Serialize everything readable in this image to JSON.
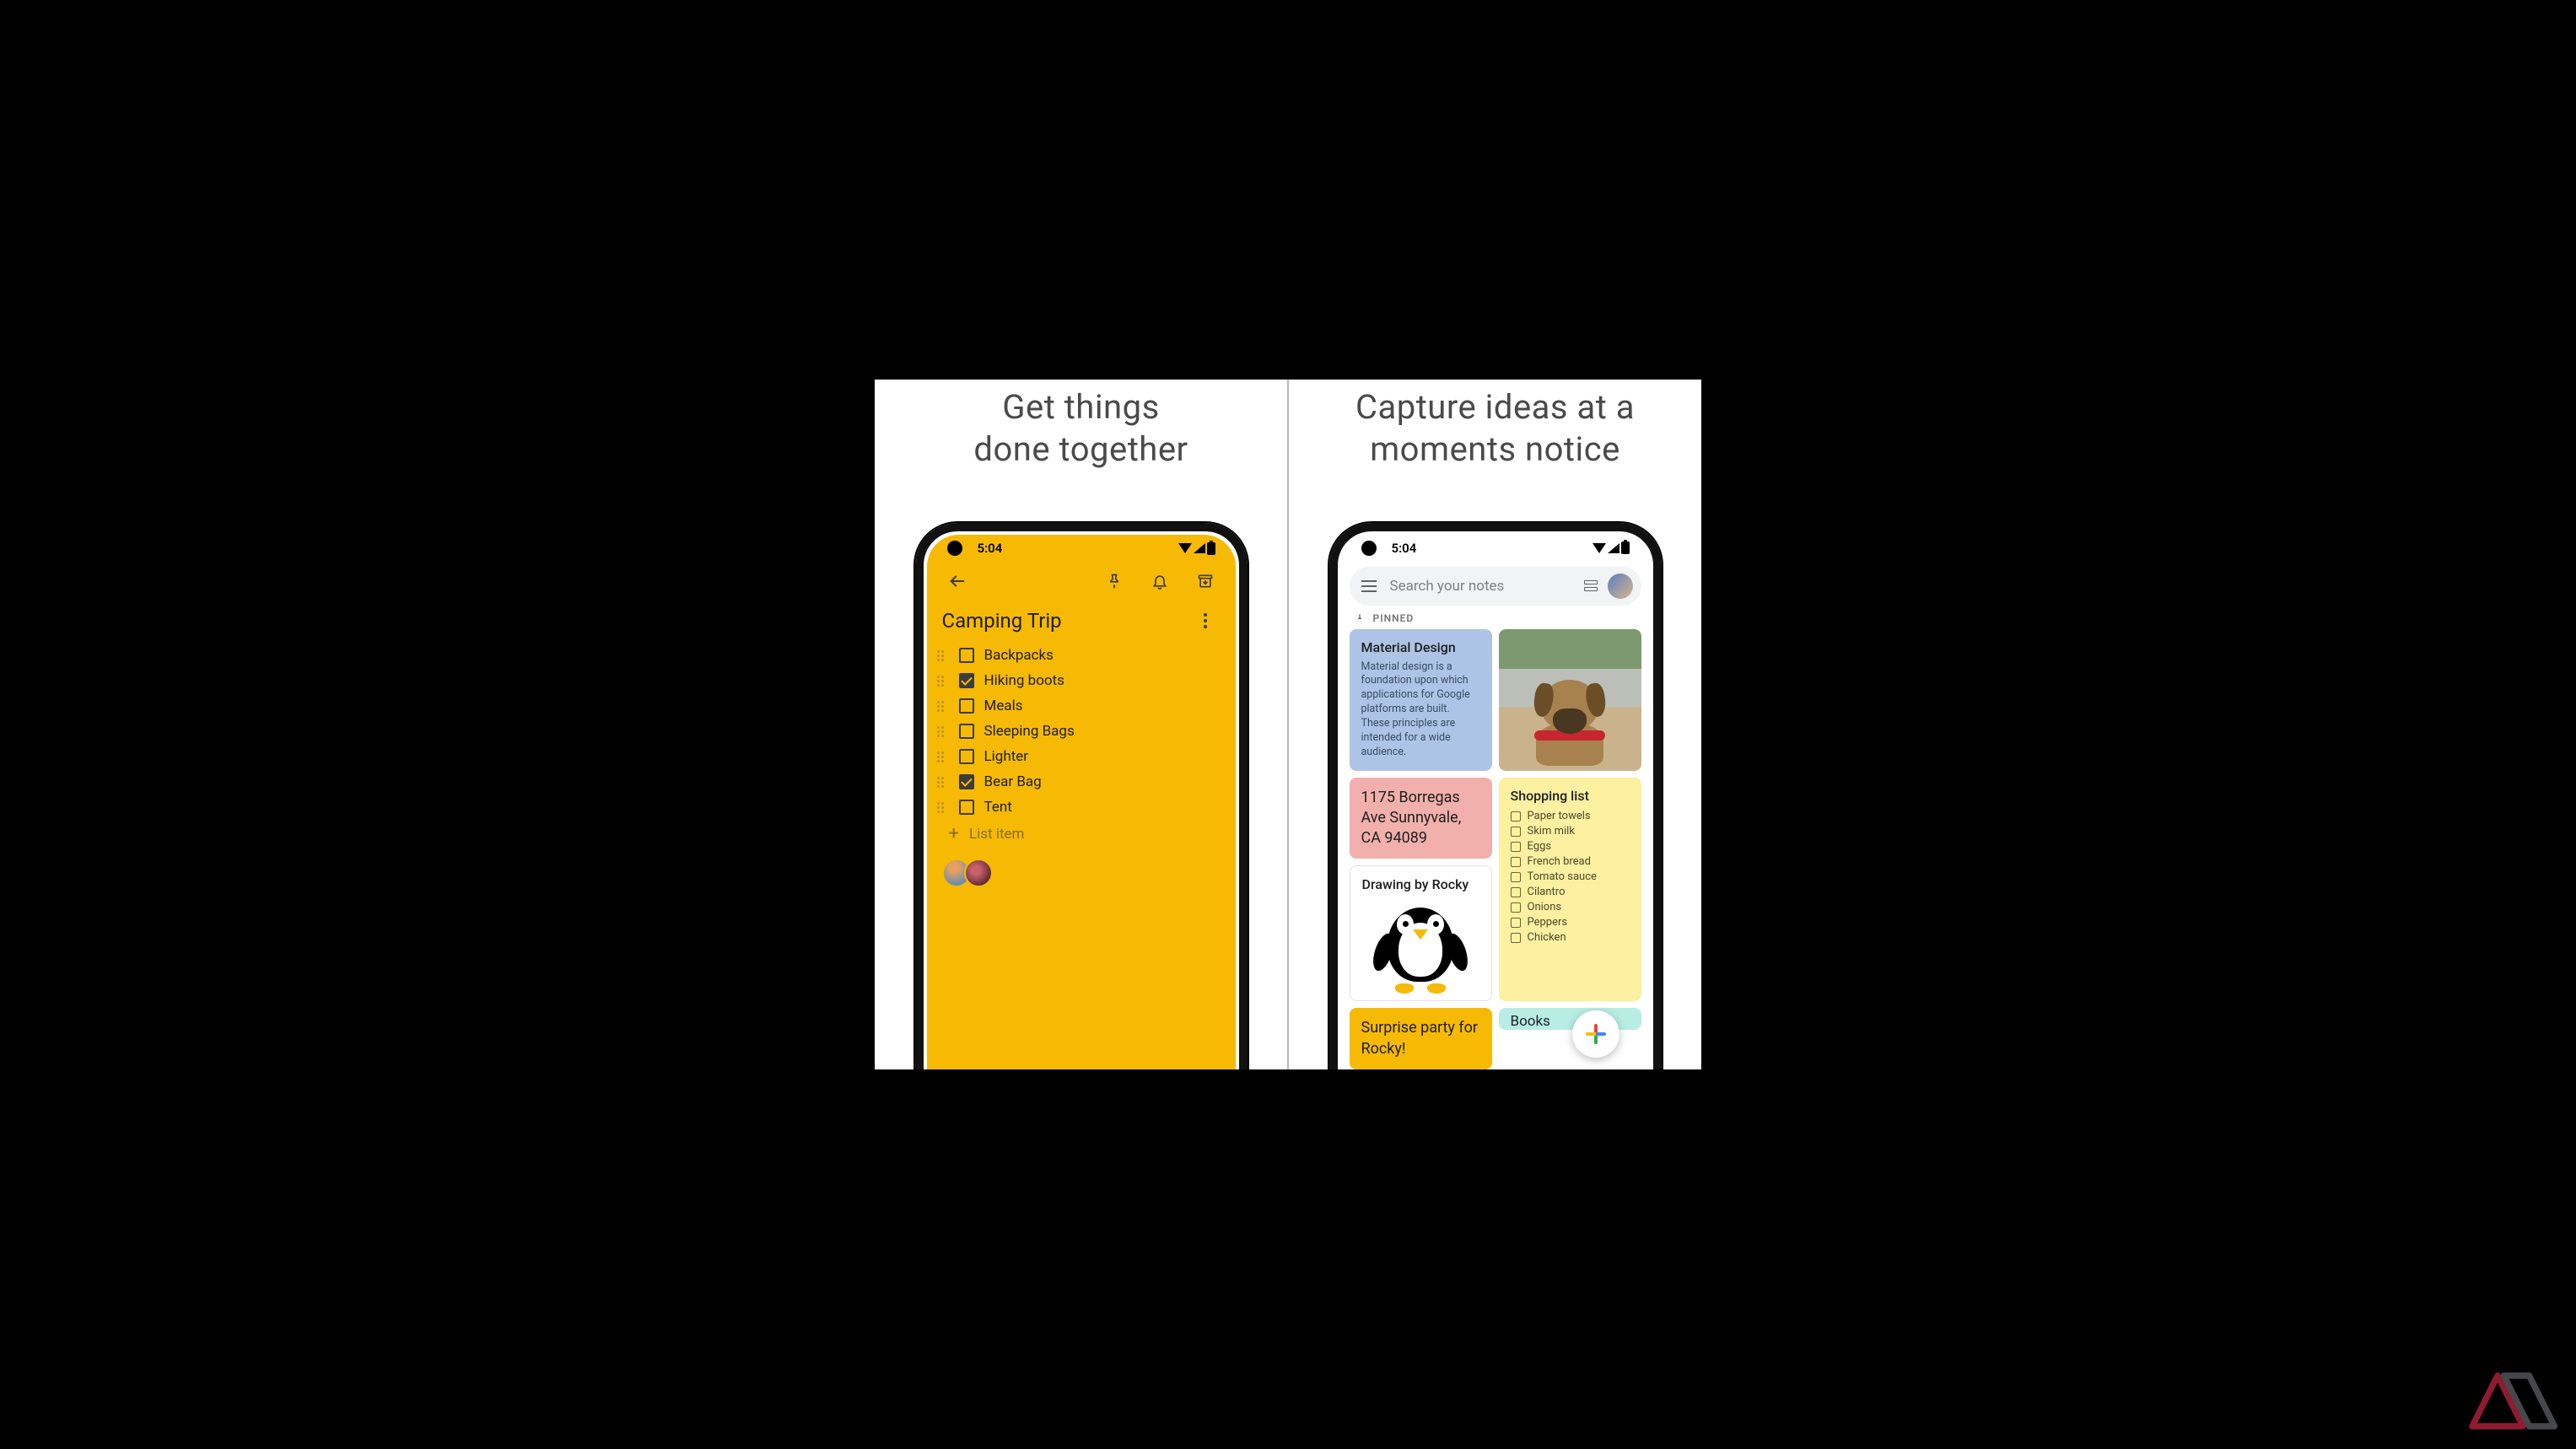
{
  "headlines": {
    "left_line1": "Get things",
    "left_line2": "done together",
    "right_line1": "Capture ideas at a",
    "right_line2": "moments notice"
  },
  "status": {
    "time": "5:04"
  },
  "left_app": {
    "note_title": "Camping Trip",
    "add_item_placeholder": "List item",
    "items": [
      {
        "label": "Backpacks",
        "checked": false
      },
      {
        "label": "Hiking boots",
        "checked": true
      },
      {
        "label": "Meals",
        "checked": false
      },
      {
        "label": "Sleeping Bags",
        "checked": false
      },
      {
        "label": "Lighter",
        "checked": false
      },
      {
        "label": "Bear Bag",
        "checked": true
      },
      {
        "label": "Tent",
        "checked": false
      }
    ]
  },
  "right_app": {
    "search_placeholder": "Search your notes",
    "pinned_label": "PINNED",
    "cards": {
      "material": {
        "title": "Material Design",
        "body": "Material design is a foundation upon which applications for Google platforms are built. These principles are intended for a wide audience."
      },
      "address": {
        "text": "1175 Borregas Ave Sunnyvale, CA 94089"
      },
      "drawing": {
        "title": "Drawing by Rocky"
      },
      "books_partial": {
        "text": "Books"
      },
      "shopping": {
        "title": "Shopping list",
        "items": [
          "Paper towels",
          "Skim milk",
          "Eggs",
          "French bread",
          "Tomato sauce",
          "Cilantro",
          "Onions",
          "Peppers",
          "Chicken"
        ]
      },
      "surprise": {
        "text": "Surprise party for Rocky!"
      }
    }
  },
  "colors": {
    "keep_yellow": "#f6b904",
    "card_blue": "#aec4e6",
    "card_pink": "#f1b0ac",
    "card_yellow": "#fdf0a0",
    "card_orange": "#f6b904",
    "card_teal": "#b7ede4"
  }
}
